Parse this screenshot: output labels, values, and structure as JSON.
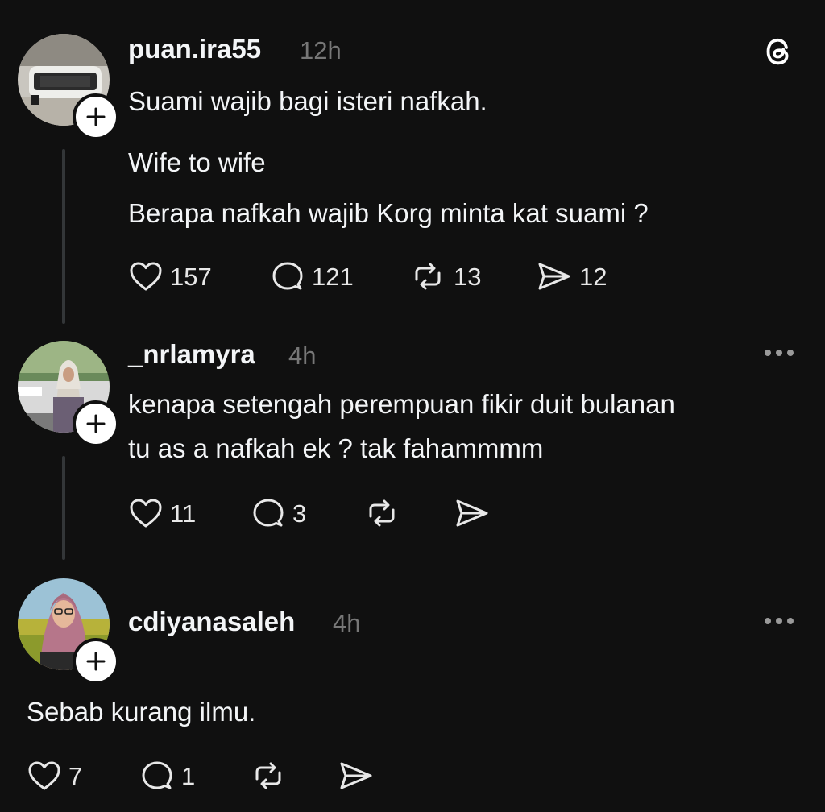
{
  "posts": [
    {
      "username": "puan.ira55",
      "time": "12h",
      "lines": [
        "Suami wajib bagi isteri nafkah.",
        "Wife to wife",
        "Berapa nafkah wajib Korg minta kat suami ?"
      ],
      "likes": "157",
      "replies": "121",
      "reposts": "13",
      "shares": "12"
    },
    {
      "username": "_nrlamyra",
      "time": "4h",
      "lines": [
        "kenapa setengah perempuan fikir duit bulanan",
        "tu as a nafkah ek ? tak fahammmm"
      ],
      "likes": "11",
      "replies": "3",
      "reposts": "",
      "shares": ""
    },
    {
      "username": "cdiyanasaleh",
      "time": "4h",
      "lines": [
        "Sebab kurang ilmu."
      ],
      "likes": "7",
      "replies": "1",
      "reposts": "",
      "shares": ""
    }
  ],
  "icons": {
    "app_logo": "threads-logo-icon",
    "like": "heart-icon",
    "reply": "comment-icon",
    "repost": "repost-icon",
    "share": "send-icon",
    "more": "more-icon",
    "follow": "plus-icon"
  },
  "colors": {
    "background": "#101010",
    "text": "#f3f5f7",
    "muted": "#777777",
    "thread_line": "#333638"
  }
}
